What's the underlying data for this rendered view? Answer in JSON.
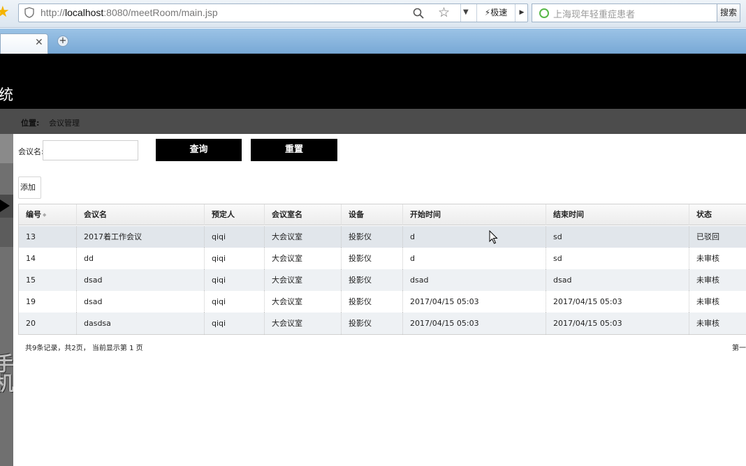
{
  "browser": {
    "url_scheme": "http://",
    "url_host": "localhost",
    "url_rest": ":8080/meetRoom/main.jsp",
    "speed_label": "极速",
    "search_placeholder": "上海现年轻重症患者",
    "search_button": "搜索"
  },
  "header": {
    "title_fragment": "统"
  },
  "location": {
    "label": "位置:",
    "value": "会议管理"
  },
  "filter": {
    "meeting_name_label": "会议名:",
    "meeting_name_value": "",
    "query_button": "查询",
    "reset_button": "重置",
    "add_button": "添加"
  },
  "grid": {
    "columns": [
      "编号",
      "会议名",
      "预定人",
      "会议室名",
      "设备",
      "开始时间",
      "结束时间",
      "状态"
    ],
    "rows": [
      [
        "13",
        "2017着工作会议",
        "qiqi",
        "大会议室",
        "投影仪",
        "d",
        "sd",
        "已驳回"
      ],
      [
        "14",
        "dd",
        "qiqi",
        "大会议室",
        "投影仪",
        "d",
        "sd",
        "未审核"
      ],
      [
        "15",
        "dsad",
        "qiqi",
        "大会议室",
        "投影仪",
        "dsad",
        "dsad",
        "未审核"
      ],
      [
        "19",
        "dsad",
        "qiqi",
        "大会议室",
        "投影仪",
        "2017/04/15 05:03",
        "2017/04/15 05:03",
        "未审核"
      ],
      [
        "20",
        "dasdsa",
        "qiqi",
        "大会议室",
        "投影仪",
        "2017/04/15 05:03",
        "2017/04/15 05:03",
        "未审核"
      ]
    ],
    "summary": "共9条记录，共2页， 当前显示第 1 页",
    "pager_first": "第一"
  },
  "colors": {
    "header_bg": "#000000",
    "location_bg": "#4c4c4c",
    "button_bg": "#000000",
    "row_alt_bg": "#eef1f4"
  }
}
